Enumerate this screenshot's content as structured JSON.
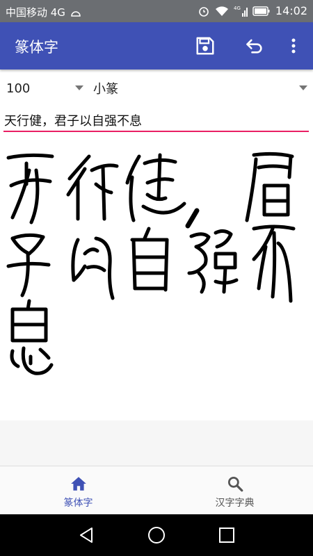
{
  "status_bar": {
    "carrier": "中国移动 4G",
    "time": "14:02",
    "network_label": "4G"
  },
  "app_bar": {
    "title": "篆体字",
    "icons": [
      "save-icon",
      "undo-icon",
      "more-vert-icon"
    ]
  },
  "controls": {
    "size_selected": "100",
    "style_selected": "小篆",
    "input_value": "天行健，君子以自强不息",
    "input_underline_color": "#e91e63"
  },
  "canvas": {
    "rendered_text": "天行健，君子以自强不息",
    "description_glyphs": [
      "天",
      "行",
      "健",
      "，",
      "君",
      "子",
      "以",
      "自",
      "强",
      "不",
      "息"
    ]
  },
  "bottom_nav": {
    "items": [
      {
        "label": "篆体字",
        "icon": "home-icon",
        "active": true
      },
      {
        "label": "汉字字典",
        "icon": "search-icon",
        "active": false
      }
    ]
  },
  "system_nav": {
    "icons": [
      "back-icon",
      "home-circle-icon",
      "recents-icon"
    ]
  },
  "colors": {
    "primary": "#3f51b5",
    "accent": "#e91e63",
    "status_bar": "#6b6e72"
  }
}
